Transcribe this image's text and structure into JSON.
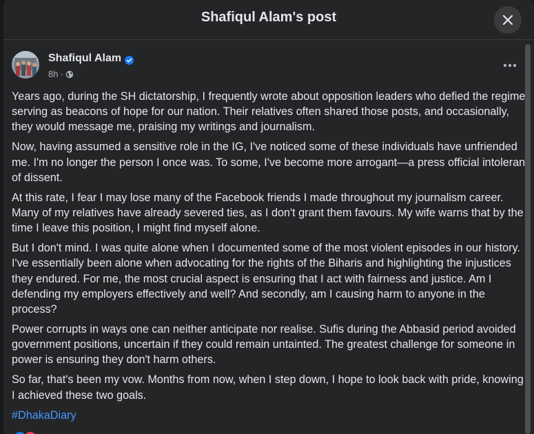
{
  "dialog": {
    "title": "Shafiqul Alam's post",
    "close_icon": "close-icon"
  },
  "post": {
    "author": "Shafiqul Alam",
    "verified_icon": "verified-badge-icon",
    "time": "8h",
    "separator": "·",
    "audience_icon": "globe-icon",
    "more_icon": "more-options-icon",
    "paragraphs": [
      "Years ago, during the SH dictatorship, I frequently wrote about opposition leaders who defied the regime, serving as beacons of hope for our nation. Their relatives often shared those posts, and occasionally, they would message me, praising my writings and journalism.",
      "Now, having assumed a sensitive role in the IG, I've noticed some of these individuals have unfriended me. I'm no longer the person I once was. To some, I've become more arrogant—a press official intolerant of dissent.",
      "At this rate, I fear I may lose many of the Facebook friends I made throughout my journalism career. Many of my relatives have already severed ties, as I don't grant them favours. My wife warns that by the time I leave this position, I might find myself alone.",
      "But I don't mind. I was quite alone when I documented some of the most violent episodes in our history. I've essentially been alone when advocating for the rights of the Biharis and highlighting the injustices they endured. For me, the most crucial aspect is ensuring that I act with fairness and justice. Am I defending my employers effectively and well? And secondly, am I causing harm to anyone in the process?",
      "Power corrupts in ways one can neither anticipate nor realise. Sufis during the Abbasid period avoided government positions, uncertain if they could remain untainted. The greatest challenge for someone in power is ensuring they don't harm others.",
      "So far, that's been my vow. Months from now, when I step down, I hope to look back with pride, knowing I achieved these two goals."
    ],
    "hashtag": "#DhakaDiary"
  },
  "colors": {
    "dialog_bg": "#242526",
    "text": "#e4e6eb",
    "secondary_text": "#b0b3b8",
    "link": "#4599ff",
    "verified": "#1877f2"
  }
}
